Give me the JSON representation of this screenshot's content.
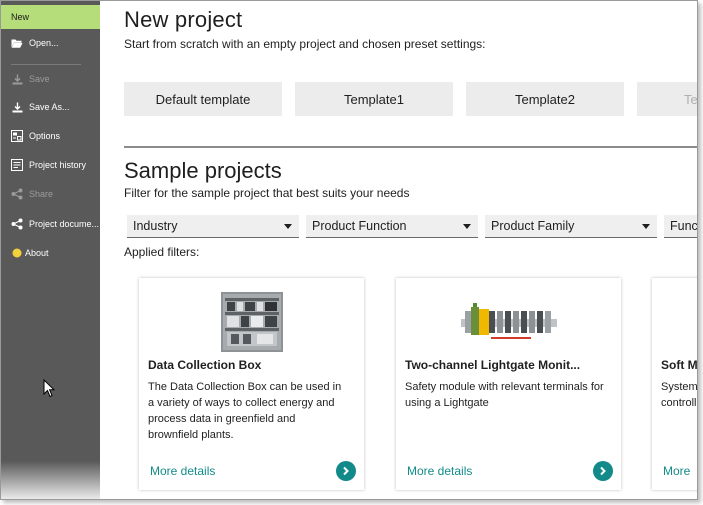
{
  "sidebar": {
    "items": [
      {
        "label": "New",
        "icon": "none",
        "state": "active"
      },
      {
        "label": "Open...",
        "icon": "folder-open-icon",
        "state": "enabled"
      },
      {
        "label": "Save",
        "icon": "save-icon",
        "state": "disabled"
      },
      {
        "label": "Save As...",
        "icon": "save-as-icon",
        "state": "enabled"
      },
      {
        "label": "Options",
        "icon": "options-icon",
        "state": "enabled"
      },
      {
        "label": "Project history",
        "icon": "history-icon",
        "state": "enabled"
      },
      {
        "label": "Share",
        "icon": "share-icon",
        "state": "disabled"
      },
      {
        "label": "Project docume...",
        "icon": "share-icon",
        "state": "enabled"
      },
      {
        "label": "About",
        "icon": "info-dot-icon",
        "state": "enabled"
      }
    ]
  },
  "new_project": {
    "title": "New project",
    "subtitle": "Start from scratch with an empty project and chosen preset settings:",
    "templates": [
      "Default template",
      "Template1",
      "Template2",
      "Te"
    ]
  },
  "sample_projects": {
    "title": "Sample projects",
    "subtitle": "Filter for the sample project that best suits your needs",
    "filters": [
      "Industry",
      "Product Function",
      "Product Family",
      "Func"
    ],
    "applied_filters_label": "Applied filters:",
    "cards": [
      {
        "title": "Data Collection Box",
        "description": "The Data Collection Box can be used in a variety of ways to collect energy and process data in greenfield and brownfield plants.",
        "more_label": "More details"
      },
      {
        "title": "Two-channel Lightgate Monit...",
        "description": "Safety module with relevant terminals for using a Lightgate",
        "more_label": "More details"
      },
      {
        "title": "Soft M",
        "description": "System controll",
        "more_label": "More"
      }
    ]
  },
  "colors": {
    "sidebar_bg": "#595959",
    "active_item_bg": "#b5dd7a",
    "accent_teal": "#138a8a",
    "template_bg": "#ececec"
  }
}
